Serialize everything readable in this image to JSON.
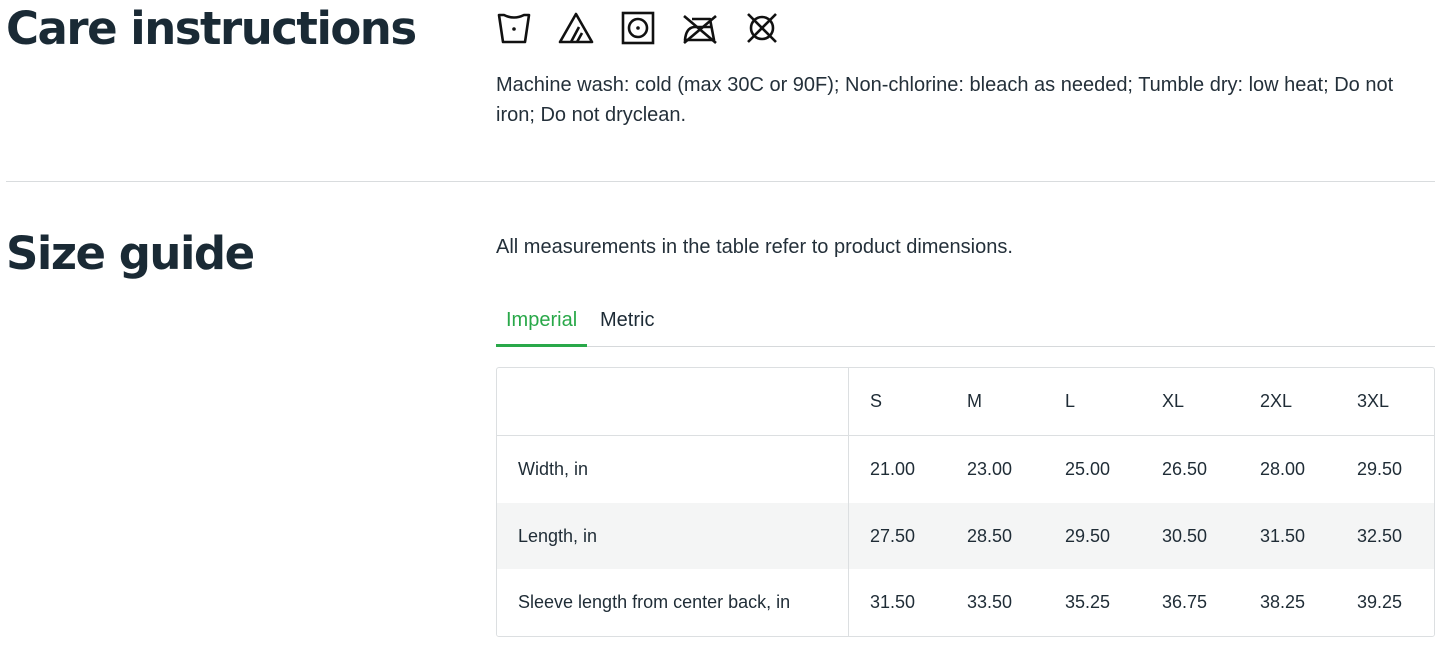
{
  "care": {
    "title": "Care instructions",
    "icons": [
      "wash-cold-icon",
      "non-chlorine-bleach-icon",
      "tumble-dry-low-icon",
      "do-not-iron-icon",
      "do-not-dryclean-icon"
    ],
    "text": "Machine wash: cold (max 30C or 90F); Non-chlorine: bleach as needed; Tumble dry: low heat; Do not iron; Do not dryclean."
  },
  "size_guide": {
    "title": "Size guide",
    "note": "All measurements in the table refer to product dimensions.",
    "tabs": [
      {
        "label": "Imperial",
        "active": true
      },
      {
        "label": "Metric",
        "active": false
      }
    ],
    "accent_color": "#29a849",
    "table": {
      "sizes": [
        "S",
        "M",
        "L",
        "XL",
        "2XL",
        "3XL"
      ],
      "rows": [
        {
          "label": "Width, in",
          "values": [
            "21.00",
            "23.00",
            "25.00",
            "26.50",
            "28.00",
            "29.50"
          ]
        },
        {
          "label": "Length, in",
          "values": [
            "27.50",
            "28.50",
            "29.50",
            "30.50",
            "31.50",
            "32.50"
          ]
        },
        {
          "label": "Sleeve length from center back, in",
          "values": [
            "31.50",
            "33.50",
            "35.25",
            "36.75",
            "38.25",
            "39.25"
          ]
        }
      ]
    }
  }
}
